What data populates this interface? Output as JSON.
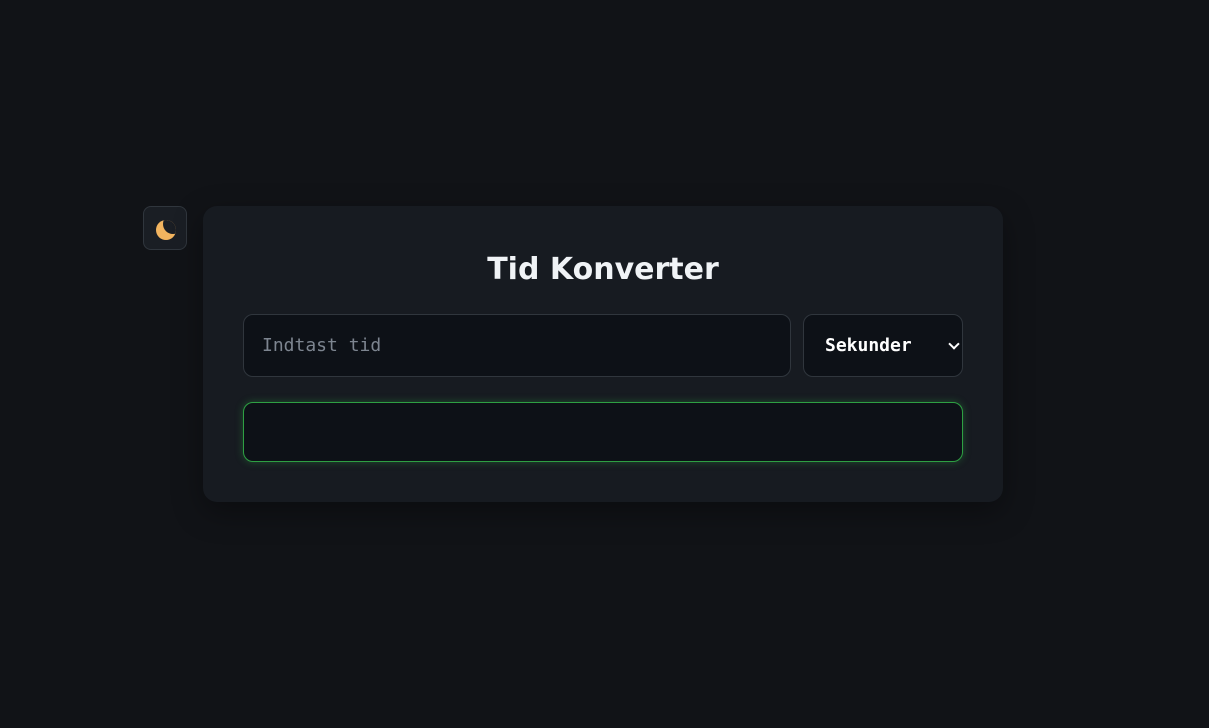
{
  "theme_toggle": {
    "icon": "moon-icon",
    "icon_color": "#f2b45f"
  },
  "converter": {
    "title": "Tid Konverter",
    "input": {
      "value": "",
      "placeholder": "Indtast tid"
    },
    "unit_select": {
      "selected": "Sekunder"
    },
    "result": {
      "text": "",
      "border_color": "#2ea043"
    }
  },
  "colors": {
    "background": "#111317",
    "card": "#171b21",
    "field": "#0d1117",
    "accent_green": "#2ea043"
  }
}
